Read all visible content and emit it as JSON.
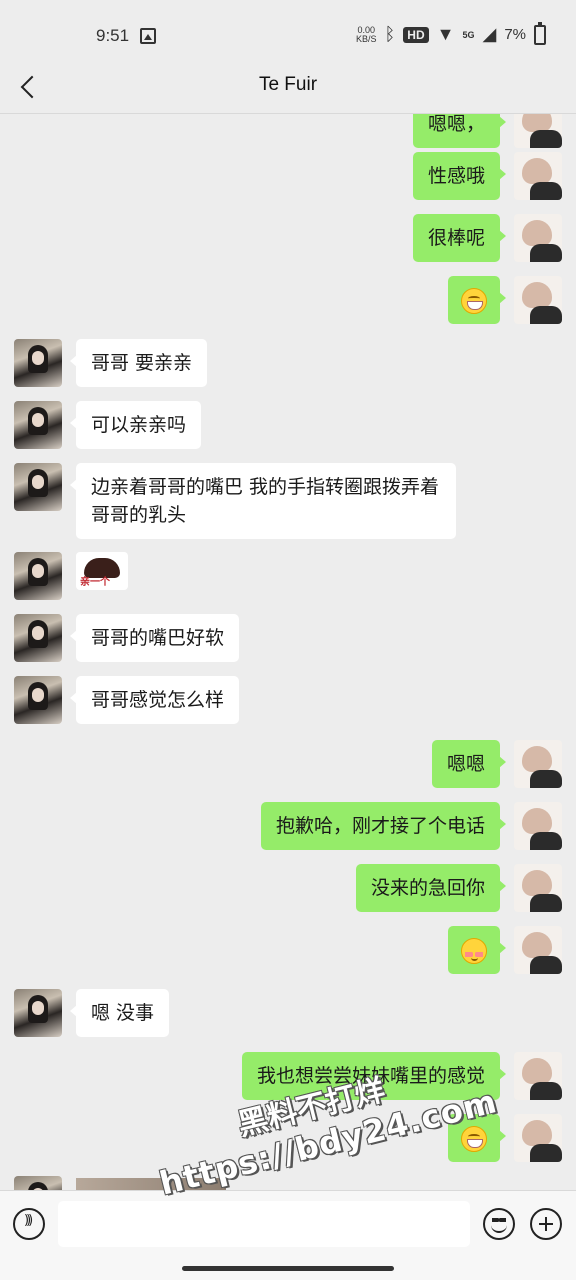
{
  "status_bar": {
    "time": "9:51",
    "net_speed_value": "0.00",
    "net_speed_unit": "KB/S",
    "hd_label": "HD",
    "network_label": "5G",
    "battery_percent": "7%"
  },
  "header": {
    "title": "Te Fuir"
  },
  "messages": [
    {
      "side": "self",
      "text": "嗯嗯，"
    },
    {
      "side": "self",
      "text": "性感哦"
    },
    {
      "side": "self",
      "text": "很棒呢"
    },
    {
      "side": "self",
      "emoji": "grin"
    },
    {
      "side": "other",
      "text": "哥哥 要亲亲"
    },
    {
      "side": "other",
      "text": "可以亲亲吗"
    },
    {
      "side": "other",
      "text": "边亲着哥哥的嘴巴 我的手指转圈跟拨弄着哥哥的乳头"
    },
    {
      "side": "other",
      "sticker": "penguin-sticker",
      "sticker_text": "亲一个"
    },
    {
      "side": "other",
      "text": "哥哥的嘴巴好软"
    },
    {
      "side": "other",
      "text": "哥哥感觉怎么样"
    },
    {
      "side": "self",
      "text": "嗯嗯"
    },
    {
      "side": "self",
      "text": "抱歉哈，刚才接了个电话"
    },
    {
      "side": "self",
      "text": "没来的急回你"
    },
    {
      "side": "self",
      "emoji": "blush"
    },
    {
      "side": "other",
      "text": "嗯 没事"
    },
    {
      "side": "self",
      "text": "我也想尝尝妹妹嘴里的感觉"
    },
    {
      "side": "self",
      "emoji": "grin"
    }
  ],
  "watermark": {
    "line1": "黑料不打烊",
    "line2": "https://bdy24.com"
  },
  "input": {
    "placeholder": ""
  }
}
